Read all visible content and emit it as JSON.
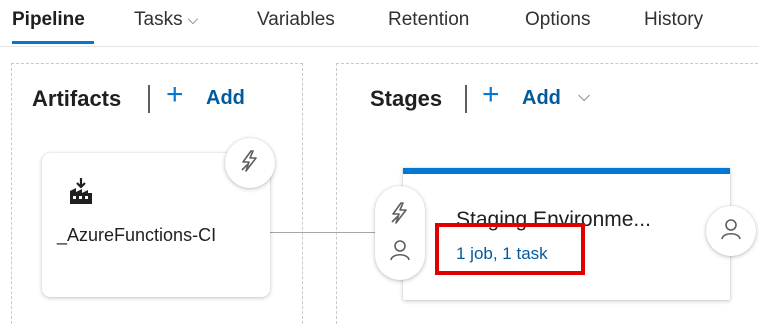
{
  "tabs": [
    {
      "label": "Pipeline",
      "active": true
    },
    {
      "label": "Tasks",
      "active": false,
      "has_dropdown": true
    },
    {
      "label": "Variables",
      "active": false
    },
    {
      "label": "Retention",
      "active": false
    },
    {
      "label": "Options",
      "active": false
    },
    {
      "label": "History",
      "active": false
    }
  ],
  "artifacts": {
    "title": "Artifacts",
    "add_label": "Add",
    "card": {
      "name": "_AzureFunctions-CI",
      "icon": "build-artifact-icon"
    },
    "trigger_icon": "lightning-icon"
  },
  "stages": {
    "title": "Stages",
    "add_label": "Add",
    "add_icon": "chevron-down-icon",
    "stage": {
      "name": "Staging Environme...",
      "summary": "1 job, 1 task",
      "pre_deploy_icons": [
        "lightning-icon",
        "person-icon"
      ],
      "post_deploy_icon": "person-icon"
    }
  },
  "colors": {
    "accent": "#0078d4",
    "link": "#005a9e",
    "highlight": "#e00000"
  }
}
